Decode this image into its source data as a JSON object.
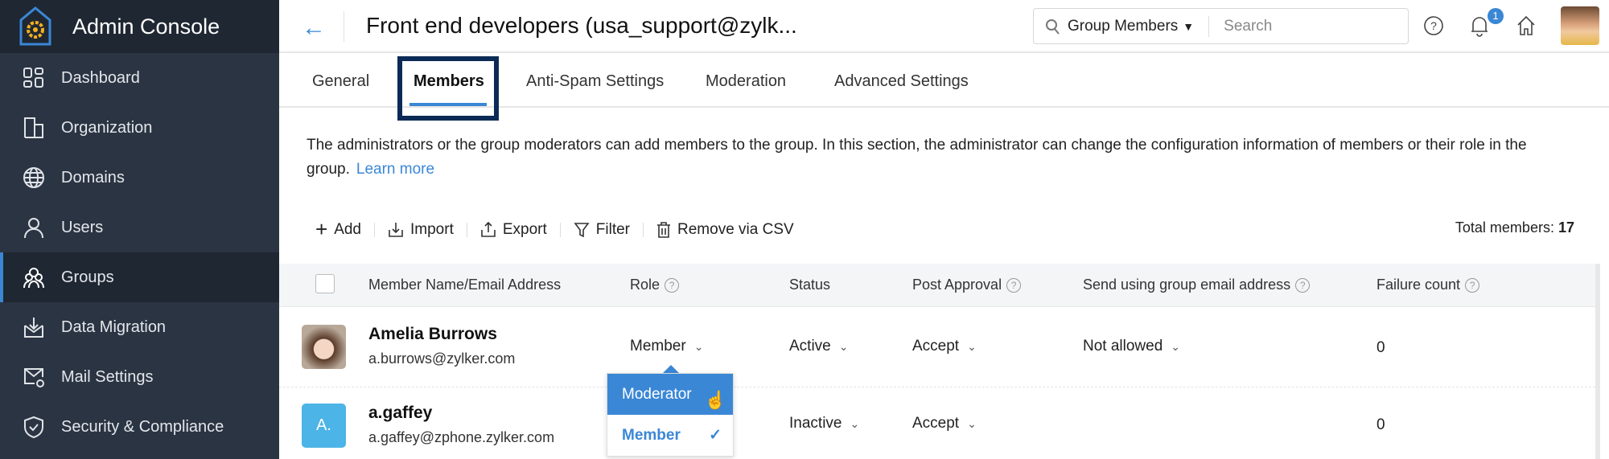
{
  "sidebar": {
    "title": "Admin Console",
    "items": [
      {
        "label": "Dashboard",
        "icon": "dashboard-icon"
      },
      {
        "label": "Organization",
        "icon": "building-icon"
      },
      {
        "label": "Domains",
        "icon": "globe-icon"
      },
      {
        "label": "Users",
        "icon": "user-icon"
      },
      {
        "label": "Groups",
        "icon": "groups-icon",
        "selected": true
      },
      {
        "label": "Data Migration",
        "icon": "data-migration-icon"
      },
      {
        "label": "Mail Settings",
        "icon": "mail-settings-icon"
      },
      {
        "label": "Security & Compliance",
        "icon": "shield-icon"
      }
    ]
  },
  "header": {
    "title": "Front end developers (usa_support@zylk...",
    "search_scope": "Group Members",
    "search_placeholder": "Search",
    "notification_count": "1"
  },
  "tabs": [
    {
      "label": "General"
    },
    {
      "label": "Members",
      "selected": true
    },
    {
      "label": "Anti-Spam Settings"
    },
    {
      "label": "Moderation"
    },
    {
      "label": "Advanced Settings"
    }
  ],
  "description": {
    "text": "The administrators or the group moderators can add members to the group. In this section, the administrator can change the configuration information of members or their role in the group.",
    "link": "Learn more"
  },
  "toolbar": {
    "add": "Add",
    "import": "Import",
    "export": "Export",
    "filter": "Filter",
    "remove_csv": "Remove via CSV",
    "total_label": "Total members:",
    "total_value": "17"
  },
  "table": {
    "columns": [
      "Member Name/Email Address",
      "Role",
      "Status",
      "Post Approval",
      "Send using group email address",
      "Failure count"
    ],
    "rows": [
      {
        "name": "Amelia Burrows",
        "email": "a.burrows@zylker.com",
        "role": "Member",
        "status": "Active",
        "post_approval": "Accept",
        "send_using": "Not allowed",
        "failure_count": "0"
      },
      {
        "name": "a.gaffey",
        "initials": "A.",
        "email": "a.gaffey@zphone.zylker.com",
        "role": "",
        "status": "Inactive",
        "post_approval": "Accept",
        "send_using": "",
        "failure_count": "0"
      }
    ]
  },
  "role_dropdown": {
    "options": [
      {
        "label": "Moderator",
        "hovered": true
      },
      {
        "label": "Member",
        "selected": true
      }
    ]
  },
  "colors": {
    "accent": "#3a87d6",
    "sidebar": "#2b3442",
    "highlight_box": "#0b2a55"
  }
}
